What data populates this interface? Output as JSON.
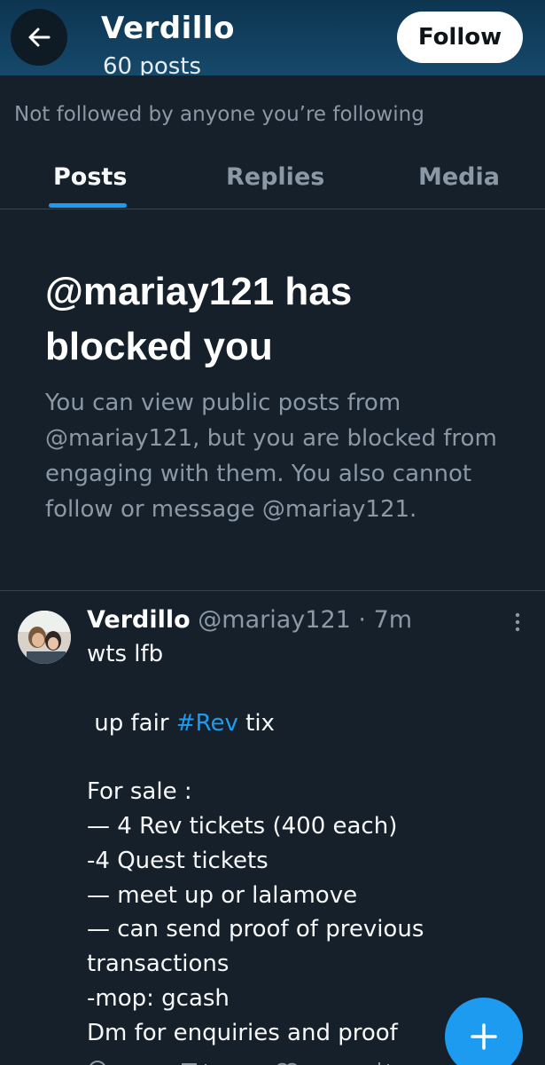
{
  "header": {
    "title": "Verdillo",
    "posts_count": "60 posts",
    "follow_label": "Follow",
    "back_icon": "arrow-left-icon"
  },
  "profile": {
    "not_followed": "Not followed by anyone you’re following"
  },
  "tabs": [
    {
      "label": "Posts",
      "active": true
    },
    {
      "label": "Replies",
      "active": false
    },
    {
      "label": "Media",
      "active": false
    }
  ],
  "blocked": {
    "title": "@mariay121 has blocked you",
    "body": "You can view public posts from @mariay121, but you are blocked from engaging with them. You also cannot follow or message @mariay121."
  },
  "post": {
    "name": "Verdillo",
    "handle": "@mariay121",
    "separator": " · ",
    "time": "7m",
    "lines": [
      "wts lfb",
      "",
      " up fair ",
      "",
      "For sale :",
      "— 4 Rev tickets (400 each)",
      "-4 Quest tickets",
      "— meet up or lalamove",
      "— can send proof of previous",
      "transactions",
      "-mop: gcash",
      "Dm for enquiries and proof"
    ],
    "hashtag": "#Rev",
    "after_hashtag": " tix"
  },
  "fab": {
    "icon": "plus-icon"
  },
  "colors": {
    "background": "#15202b",
    "accent": "#1d9bf0",
    "muted_text": "#8b98a5"
  }
}
